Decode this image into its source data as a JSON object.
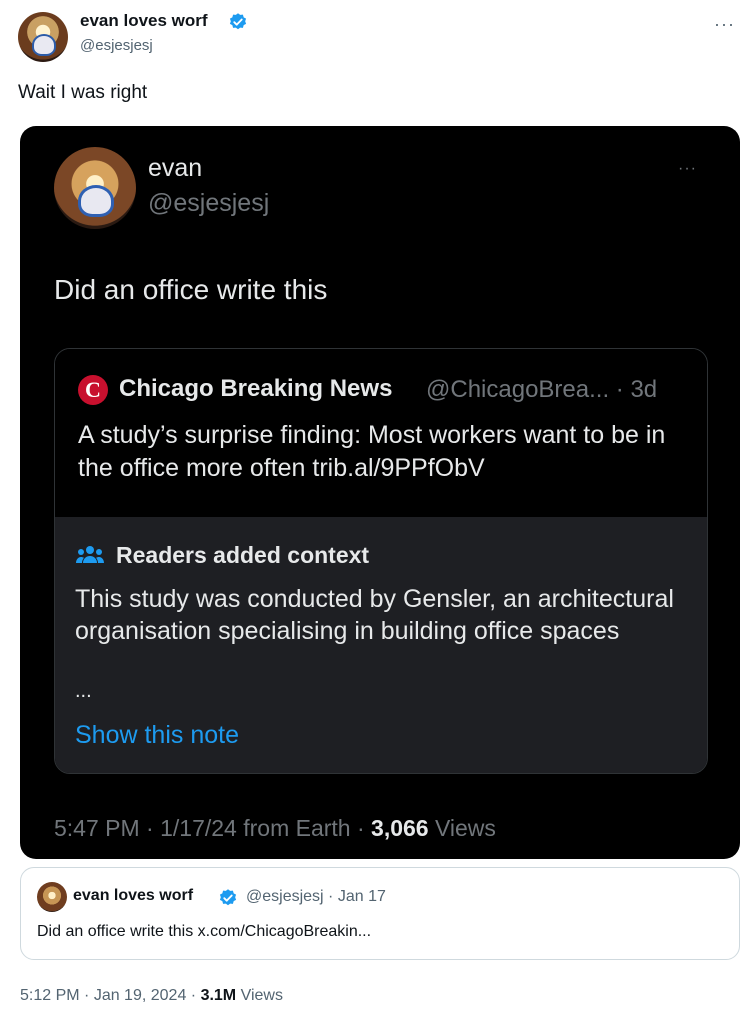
{
  "outer": {
    "name": "evan loves worf",
    "handle": "@esjesjesj",
    "more": "···",
    "text": "Wait I was right",
    "meta_time": "5:12 PM",
    "meta_sep1": " · ",
    "meta_date": "Jan 19, 2024",
    "meta_sep2": " · ",
    "views": "3.1M",
    "views_label": " Views"
  },
  "embedded": {
    "name": "evan",
    "handle": "@esjesjesj",
    "more": "···",
    "text": "Did an office write this",
    "quote": {
      "logo_letter": "C",
      "name": "Chicago Breaking News",
      "handle_time": "@ChicagoBrea... · 3d",
      "text": "A study’s surprise finding: Most workers want to be in the office more often trib.al/9PPfObV"
    },
    "note": {
      "title": "Readers added context",
      "text": "This study was conducted by Gensler, an architectural organisation specialising in building office spaces",
      "ellipsis": "...",
      "link": "Show this note"
    },
    "meta_prefix": "5:47 PM · 1/17/24 from Earth · ",
    "views": "3,066",
    "views_label": " Views"
  },
  "quoted": {
    "name": "evan loves worf",
    "handle_date": "@esjesjesj · Jan 17",
    "text": "Did an office write this x.com/ChicagoBreakin..."
  },
  "colors": {
    "accent": "#1d9bf0",
    "dark_bg": "#000000",
    "note_bg": "#1e1f23",
    "brand_red": "#c8102e"
  },
  "icons": [
    "verified-badge-icon",
    "more-icon",
    "people-icon"
  ]
}
